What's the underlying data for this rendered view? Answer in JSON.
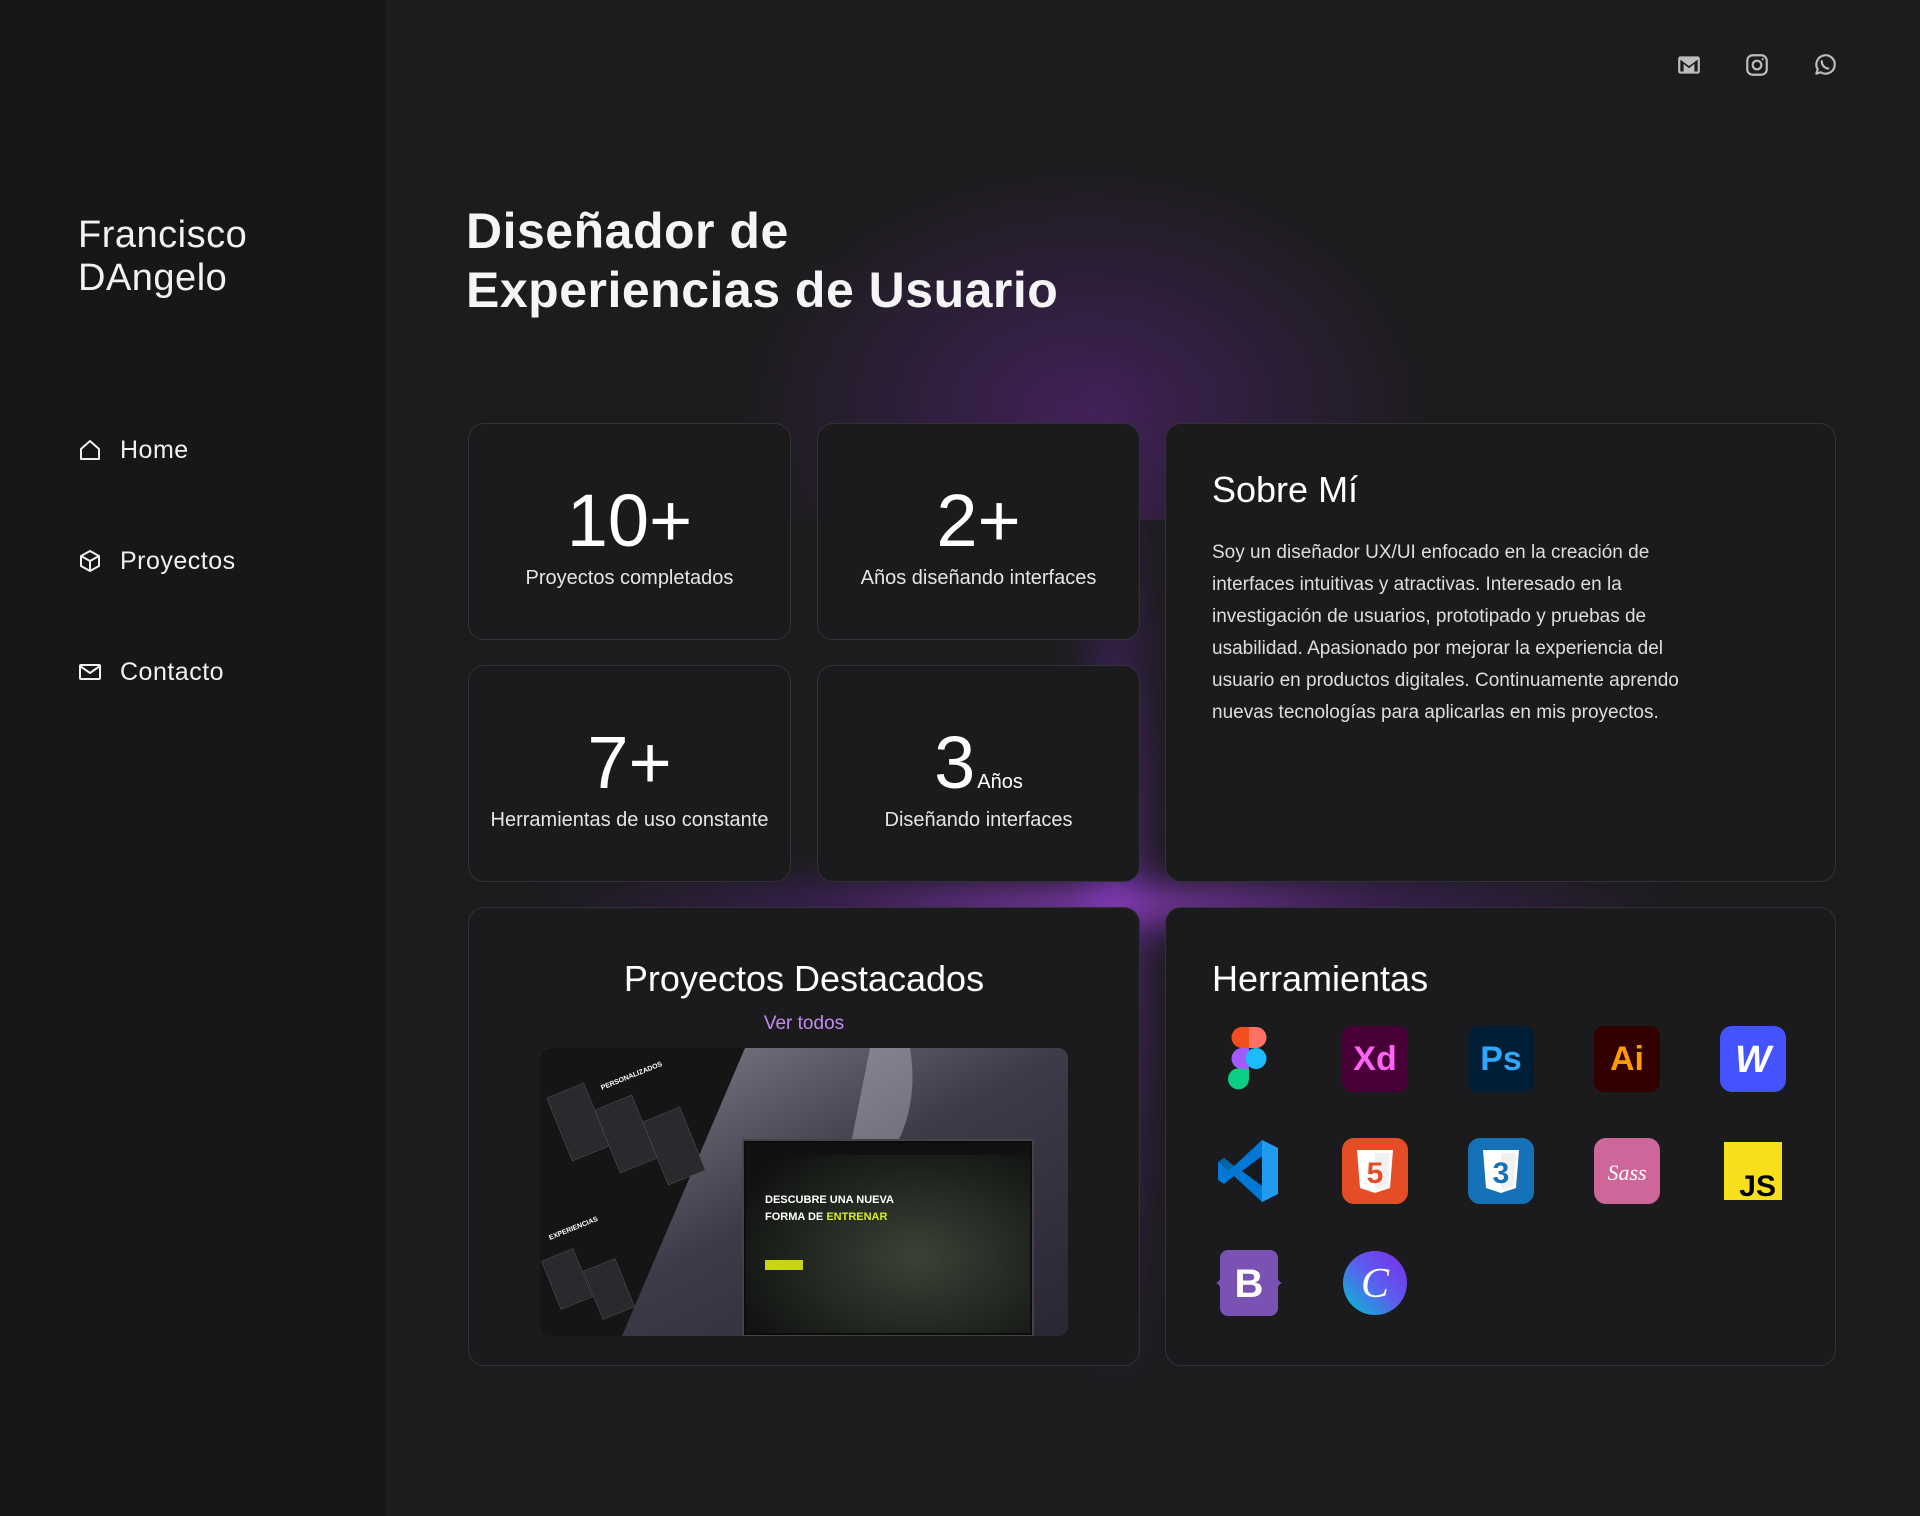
{
  "brand": {
    "first": "Francisco",
    "last": "DAngelo"
  },
  "nav": [
    {
      "label": "Home",
      "icon": "home-icon"
    },
    {
      "label": "Proyectos",
      "icon": "cube-icon"
    },
    {
      "label": "Contacto",
      "icon": "mail-icon"
    }
  ],
  "social": [
    "gmail-icon",
    "instagram-icon",
    "whatsapp-icon"
  ],
  "hero": {
    "line1": "Diseñador de",
    "line2": "Experiencias de Usuario"
  },
  "stats": [
    {
      "value": "10+",
      "suffix": "",
      "label": "Proyectos completados"
    },
    {
      "value": "2+",
      "suffix": "",
      "label": "Años diseñando interfaces"
    },
    {
      "value": "7+",
      "suffix": "",
      "label": "Herramientas de uso constante"
    },
    {
      "value": "3",
      "suffix": "Años",
      "label": "Diseñando interfaces"
    }
  ],
  "about": {
    "title": "Sobre Mí",
    "text": "Soy un diseñador UX/UI enfocado en la creación de interfaces intuitivas y atractivas. Interesado en la investigación de usuarios, prototipado y pruebas de usabilidad. Apasionado por mejorar la experiencia del usuario en productos digitales. Continuamente aprendo nuevas tecnologías para aplicarlas en mis proyectos."
  },
  "projects": {
    "title": "Proyectos Destacados",
    "link": "Ver todos",
    "preview": {
      "headline1": "DESCUBRE UNA NUEVA",
      "headline2a": "FORMA DE ",
      "headline2b": "ENTRENAR",
      "side1": "PERSONALIZADOS",
      "side2": "EXPERIENCIAS"
    }
  },
  "tools": {
    "title": "Herramientas",
    "items": [
      "figma-icon",
      "adobe-xd-icon",
      "photoshop-icon",
      "illustrator-icon",
      "webflow-icon",
      "vscode-icon",
      "html5-icon",
      "css3-icon",
      "sass-icon",
      "javascript-icon",
      "bootstrap-icon",
      "canva-icon"
    ],
    "labels": {
      "xd": "Xd",
      "ps": "Ps",
      "ai": "Ai",
      "w": "W",
      "js": "JS",
      "b": "B",
      "c": "C",
      "sass": "Sass",
      "html": "5",
      "css": "3"
    }
  },
  "colors": {
    "accent": "#a855f7",
    "link": "#c38cf0",
    "card": "#1b1a1d",
    "sidebar": "#171718"
  }
}
